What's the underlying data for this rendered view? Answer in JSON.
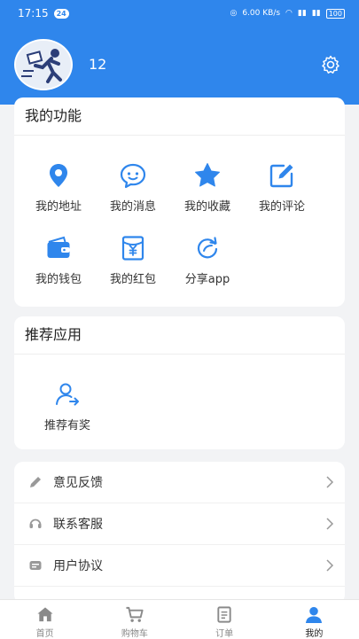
{
  "status_bar": {
    "time": "17:15",
    "notification_count": "24",
    "network_speed": "6.00\nKB/S",
    "battery": "100"
  },
  "profile": {
    "username": "12"
  },
  "functions": {
    "title": "我的功能",
    "items": [
      {
        "label": "我的地址",
        "icon": "location-icon"
      },
      {
        "label": "我的消息",
        "icon": "message-icon"
      },
      {
        "label": "我的收藏",
        "icon": "star-icon"
      },
      {
        "label": "我的评论",
        "icon": "edit-icon"
      },
      {
        "label": "我的钱包",
        "icon": "wallet-icon"
      },
      {
        "label": "我的红包",
        "icon": "red-packet-icon"
      },
      {
        "label": "分享app",
        "icon": "share-icon"
      }
    ]
  },
  "recommend": {
    "title": "推荐应用",
    "items": [
      {
        "label": "推荐有奖",
        "icon": "referral-icon"
      }
    ]
  },
  "menu": [
    {
      "label": "意见反馈",
      "icon": "pencil-icon"
    },
    {
      "label": "联系客服",
      "icon": "headset-icon"
    },
    {
      "label": "用户协议",
      "icon": "agreement-icon"
    }
  ],
  "tabs": [
    {
      "label": "首页",
      "icon": "home-icon"
    },
    {
      "label": "购物车",
      "icon": "cart-icon"
    },
    {
      "label": "订单",
      "icon": "order-icon"
    },
    {
      "label": "我的",
      "icon": "user-icon",
      "active": true
    }
  ],
  "colors": {
    "primary": "#2f86ec",
    "background": "#f2f3f5",
    "icon_gray": "#999999"
  }
}
